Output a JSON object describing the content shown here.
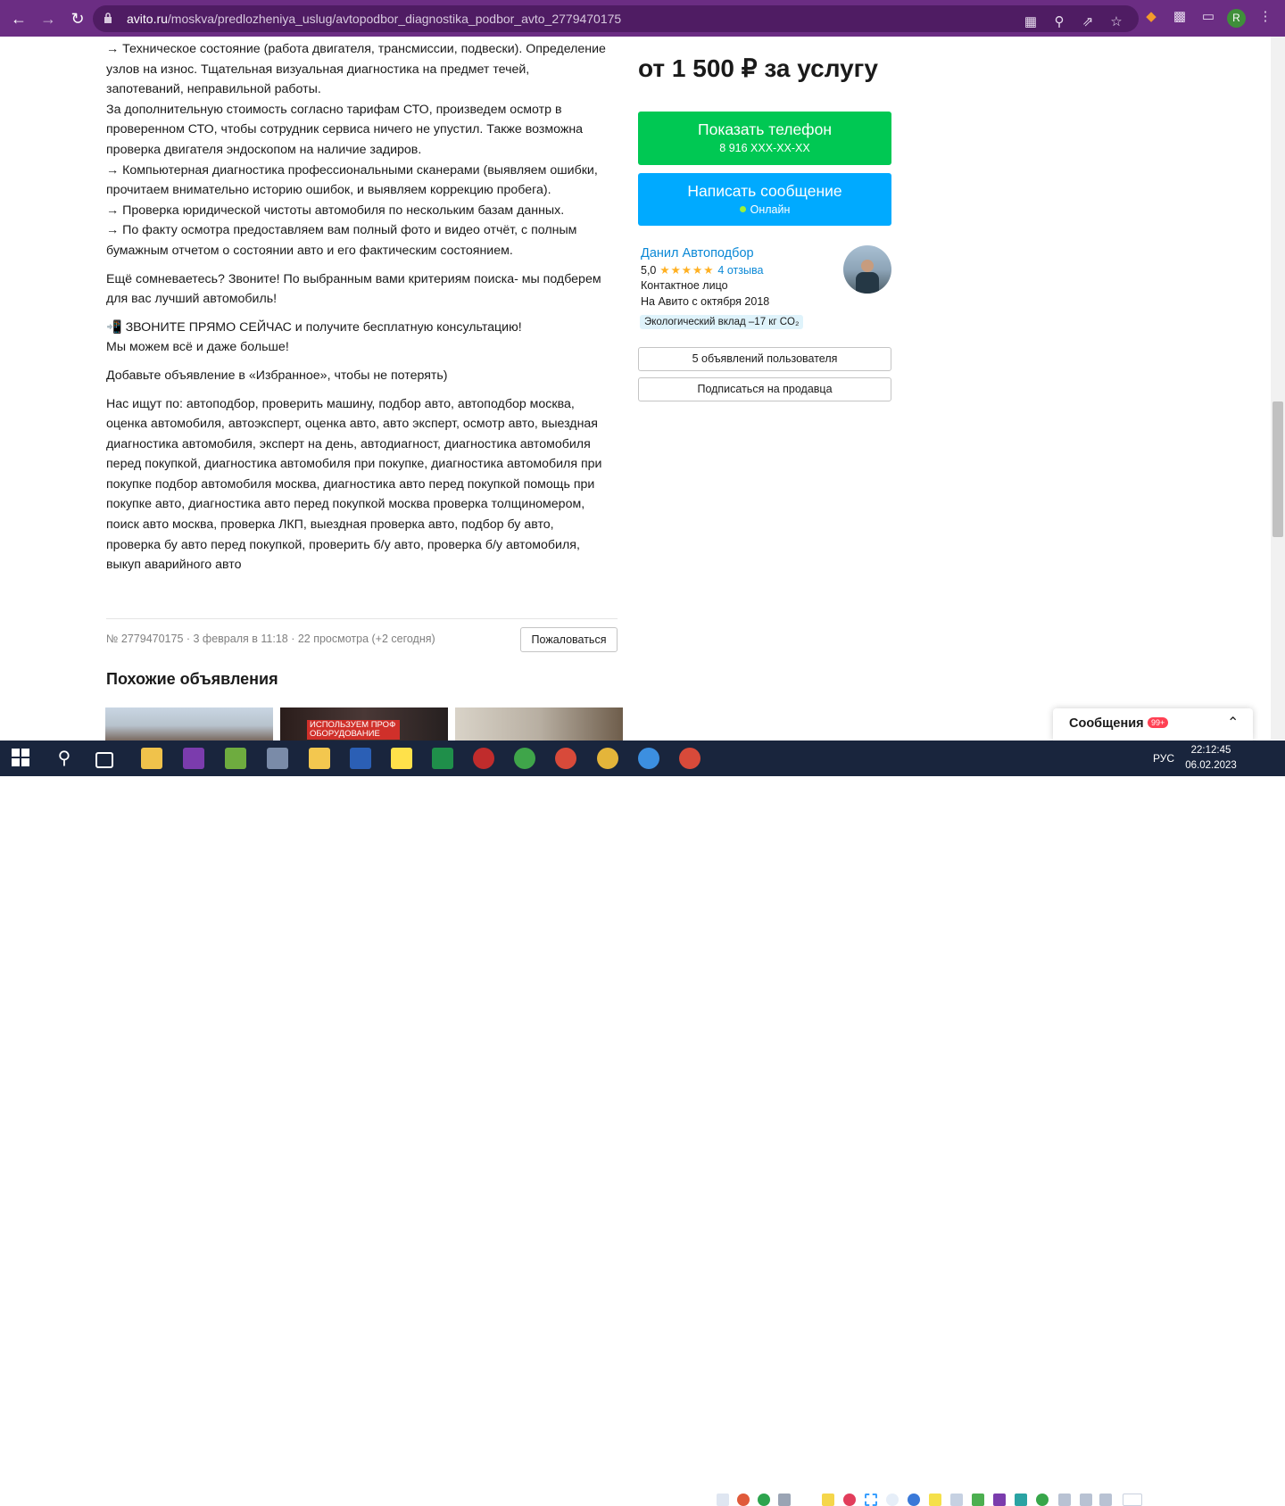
{
  "browser": {
    "url_domain": "avito.ru",
    "url_path": "/moskva/predlozheniya_uslug/avtopodbor_diagnostika_podbor_avto_2779470175",
    "profile_initial": "R"
  },
  "description": {
    "lines": [
      "→ Техническое состояние (работа двигателя, трансмиссии, подвески). Определение",
      "узлов на износ. Тщательная визуальная диагностика на предмет течей,",
      "запотеваний, неправильной работы.",
      "За дополнительную стоимость согласно тарифам СТО, произведем осмотр в",
      "проверенном СТО, чтобы сотрудник сервиса ничего не упустил. Также возможна",
      "проверка двигателя эндоскопом на наличие задиров.",
      "→ Компьютерная диагностика профессиональными сканерами (выявляем ошибки,",
      "прочитаем внимательно историю ошибок, и выявляем коррекцию пробега).",
      "→ Проверка юридической чистоты автомобиля по нескольким базам данных.",
      "→ По факту осмотра предоставляем вам полный фото и видео отчёт, с полным",
      "бумажным отчетом о состоянии авто и его фактическим состоянием."
    ],
    "para2": [
      "Ещё сомневаетесь? Звоните! По выбранным вами критериям поиска- мы подберем",
      "для вас лучший автомобиль!"
    ],
    "para3": [
      "📲 ЗВОНИТЕ ПРЯМО СЕЙЧАС и получите бесплатную консультацию!",
      "Мы можем всё и даже больше!"
    ],
    "para4": "Добавьте объявление в «Избранное», чтобы не потерять)",
    "para5": [
      "Нас ищут по: автоподбор, проверить машину, подбор авто, автоподбор москва,",
      "оценка автомобиля, автоэксперт, оценка авто, авто эксперт, осмотр авто, выездная",
      "диагностика автомобиля, эксперт на день, автодиагност, диагностика автомобиля",
      "перед покупкой, диагностика автомобиля при покупке, диагностика автомобиля при",
      "покупке подбор автомобиля москва, диагностика авто перед покупкой помощь при",
      "покупке авто, диагностика авто перед покупкой москва проверка толщиномером,",
      "поиск авто москва, проверка ЛКП, выездная проверка авто, подбор бу авто,",
      "проверка бу авто перед покупкой, проверить б/у авто, проверка б/у автомобиля,",
      "выкуп аварийного авто"
    ]
  },
  "listing": {
    "meta": "№ 2779470175 · 3 февраля в 11:18 · 22 просмотра (+2 сегодня)",
    "report_label": "Пожаловаться",
    "similar_title": "Похожие объявления",
    "thumb2_caption": "ИСПОЛЬЗУЕМ ПРОФ ОБОРУДОВАНИЕ"
  },
  "sidebar": {
    "price": "от 1 500 ₽ за услугу",
    "phone_button": "Показать телефон",
    "phone_masked": "8 916 XXX-XX-XX",
    "message_button": "Написать сообщение",
    "online_status": "Онлайн",
    "seller_name": "Данил Автоподбор",
    "rating_value": "5,0",
    "rating_stars": 5,
    "reviews": "4 отзыва",
    "contact_type": "Контактное лицо",
    "since": "На Авито с октября 2018",
    "eco": "Экологический вклад –17 кг CO₂",
    "user_ads_button": "5 объявлений пользователя",
    "subscribe_button": "Подписаться на продавца"
  },
  "messages": {
    "label": "Сообщения",
    "badge": "99+"
  },
  "taskbar": {
    "lang": "РУС",
    "time": "22:12:45",
    "date": "06.02.2023"
  },
  "colors": {
    "browser_bar": "#6b2d83",
    "green_button": "#00c853",
    "blue_button": "#00aaff",
    "link": "#0a88d6",
    "taskbar": "#19253d"
  }
}
